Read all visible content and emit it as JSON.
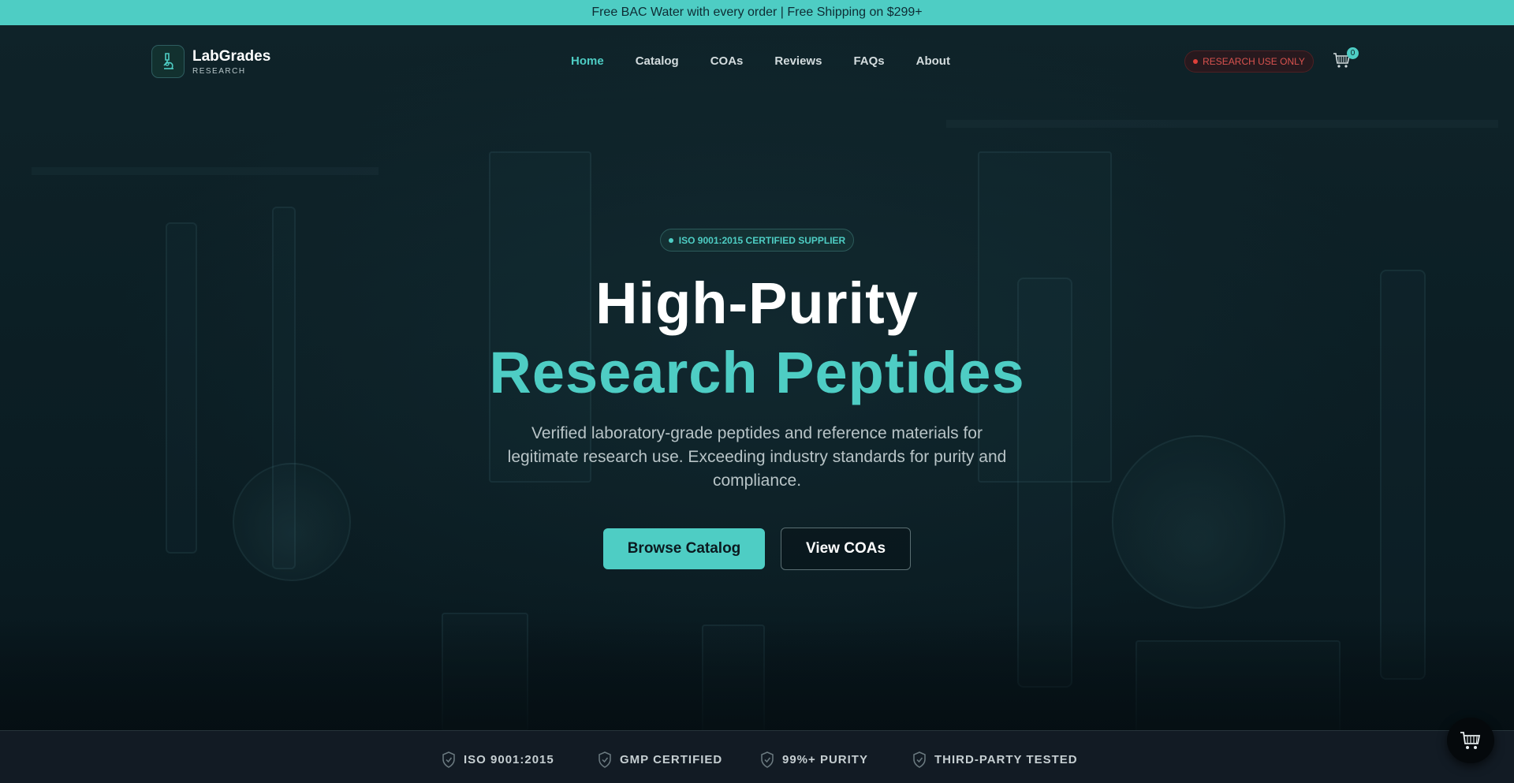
{
  "announcement": "Free BAC Water with every order | Free Shipping on $299+",
  "brand": {
    "name": "LabGrades",
    "tagline": "RESEARCH"
  },
  "nav": {
    "items": [
      {
        "label": "Home",
        "active": true
      },
      {
        "label": "Catalog"
      },
      {
        "label": "COAs"
      },
      {
        "label": "Reviews"
      },
      {
        "label": "FAQs"
      },
      {
        "label": "About"
      }
    ]
  },
  "research_badge": "RESEARCH USE ONLY",
  "cart": {
    "count": "0"
  },
  "hero": {
    "certification": "ISO 9001:2015 CERTIFIED SUPPLIER",
    "title_line1": "High-Purity",
    "title_line2": "Research Peptides",
    "description": "Verified laboratory-grade peptides and reference materials for legitimate research use. Exceeding industry standards for purity and compliance.",
    "primary_cta": "Browse Catalog",
    "secondary_cta": "View COAs"
  },
  "trust_badges": [
    {
      "label": "ISO 9001:2015",
      "icon": "shield-check-icon"
    },
    {
      "label": "GMP CERTIFIED",
      "icon": "shield-check-icon"
    },
    {
      "label": "99%+ PURITY",
      "icon": "shield-check-icon"
    },
    {
      "label": "THIRD-PARTY TESTED",
      "icon": "shield-check-icon"
    }
  ],
  "colors": {
    "accent": "#4ecdc4",
    "background": "#0b1a20",
    "warning": "#d9534f"
  }
}
